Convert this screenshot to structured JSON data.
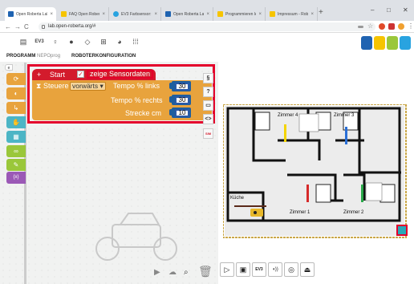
{
  "browser": {
    "tabs": [
      {
        "title": "Open Roberta Lab",
        "fav": "#1f63b1"
      },
      {
        "title": "FAQ Open Roberta La",
        "fav": "#f6c400"
      },
      {
        "title": "EV3 Farbsensor: Anmeld",
        "fav": "#29a3e0"
      },
      {
        "title": "Open Roberta Lab",
        "fav": "#1f63b1"
      },
      {
        "title": "Programmieren lernen",
        "fav": "#f6c400"
      },
      {
        "title": "Impressum - Roberta",
        "fav": "#f6c400"
      }
    ],
    "url": "lab.open-roberta.org/#"
  },
  "toolbar": {
    "robot_label": "EV3"
  },
  "program_tabs": {
    "program": "PROGRAMM",
    "program_name": "NEPOprog",
    "robot_config": "ROBOTERKONFIGURATION"
  },
  "categories": [
    {
      "icon": "⟳",
      "color": "#e8a33d"
    },
    {
      "icon": "◐",
      "color": "#e8a33d"
    },
    {
      "icon": "↳",
      "color": "#e8a33d"
    },
    {
      "icon": "✋",
      "color": "#4cb5c5"
    },
    {
      "icon": "▦",
      "color": "#4cb5c5"
    },
    {
      "icon": "∞",
      "color": "#9ac73a"
    },
    {
      "icon": "✎",
      "color": "#9ac73a"
    },
    {
      "icon": "{x}",
      "color": "#9b59b6"
    }
  ],
  "program": {
    "plus": "+",
    "start_label": "Start",
    "sensor_label": "zeige Sensordaten",
    "steer_label": "Steuere",
    "direction": "vorwärts",
    "speed_left_label": "Tempo % links",
    "speed_left_value": "30",
    "speed_right_label": "Tempo % rechts",
    "speed_right_value": "30",
    "distance_label": "Strecke cm",
    "distance_value": "10"
  },
  "side_buttons": [
    "§",
    "?",
    "▭",
    "<>"
  ],
  "simulation": {
    "rooms": [
      "Zimmer 4",
      "Zimmer 3",
      "Küche",
      "Zimmer 1",
      "Zimmer 2"
    ]
  },
  "sim_buttons": [
    "▷",
    "▣",
    "EV3",
    "◖))",
    "◎",
    "⏏"
  ],
  "colors": {
    "block_red": "#d31b2c",
    "block_orange": "#e8a33d",
    "highlight": "#e4002b",
    "number_blue": "#1e5e9e"
  }
}
